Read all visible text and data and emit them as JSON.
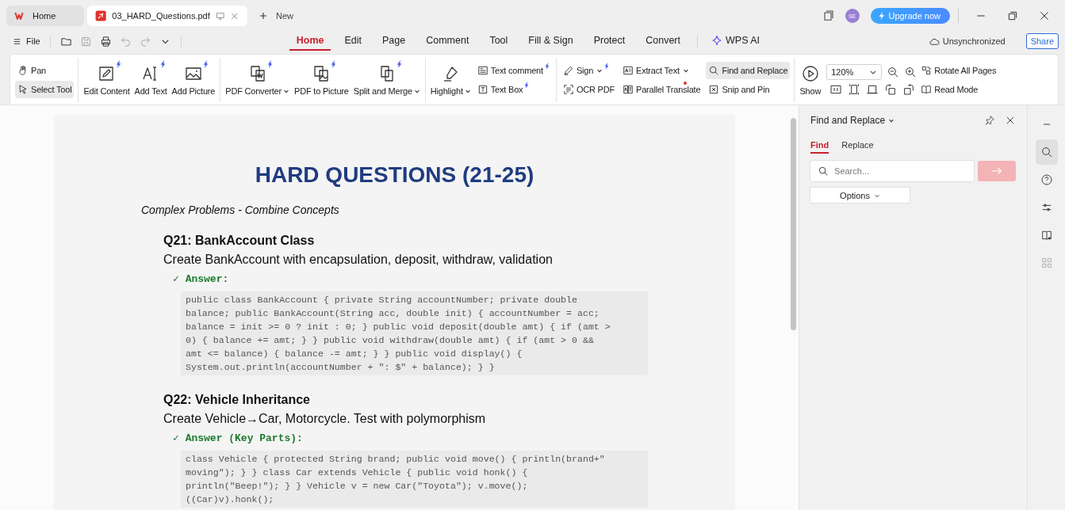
{
  "tabs": [
    {
      "label": "Home",
      "kind": "home",
      "selected": false
    },
    {
      "label": "03_HARD_Questions.pdf",
      "kind": "doc",
      "selected": true
    }
  ],
  "new_tab": "New",
  "avatar": "SE",
  "upgrade": "Upgrade now",
  "file_menu": "File",
  "ribbon_tabs": [
    {
      "label": "Home",
      "selected": true
    },
    {
      "label": "Edit",
      "selected": false
    },
    {
      "label": "Page",
      "selected": false
    },
    {
      "label": "Comment",
      "selected": false
    },
    {
      "label": "Tool",
      "selected": false
    },
    {
      "label": "Fill & Sign",
      "selected": false
    },
    {
      "label": "Protect",
      "selected": false
    },
    {
      "label": "Convert",
      "selected": false
    },
    {
      "label": "WPS AI",
      "selected": false,
      "kind": "ai"
    }
  ],
  "sync_status": "Unsynchronized",
  "share": "Share",
  "ribbon": {
    "groups": [
      {
        "columns": [
          {
            "kind": "small",
            "items": [
              {
                "label": "Pan",
                "selected": false
              },
              {
                "label": "Select Tool",
                "selected": true
              }
            ]
          }
        ]
      },
      {
        "columns": [
          {
            "kind": "large",
            "items": [
              {
                "label": "Edit Content",
                "selected": false,
                "spark": true
              }
            ]
          },
          {
            "kind": "large",
            "items": [
              {
                "label": "Add Text",
                "selected": false,
                "spark": true
              }
            ]
          },
          {
            "kind": "large",
            "items": [
              {
                "label": "Add Picture",
                "selected": false,
                "spark": true
              }
            ]
          }
        ]
      },
      {
        "columns": [
          {
            "kind": "large",
            "items": [
              {
                "label": "PDF Converter",
                "selected": false,
                "spark": true,
                "dropdown": true
              }
            ]
          },
          {
            "kind": "large",
            "items": [
              {
                "label": "PDF to Picture",
                "selected": false,
                "spark": true
              }
            ]
          },
          {
            "kind": "large",
            "items": [
              {
                "label": "Split and Merge",
                "selected": false,
                "spark": true,
                "dropdown": true
              }
            ]
          }
        ]
      },
      {
        "columns": [
          {
            "kind": "large",
            "items": [
              {
                "label": "Highlight",
                "selected": false,
                "dropdown": true
              }
            ]
          },
          {
            "kind": "small",
            "items": [
              {
                "label": "Text comment",
                "selected": false,
                "spark": true
              },
              {
                "label": "Text Box",
                "selected": false,
                "spark": true
              }
            ]
          }
        ]
      },
      {
        "columns": [
          {
            "kind": "small",
            "items": [
              {
                "label": "Sign",
                "selected": false,
                "spark": true,
                "dropdown": true
              },
              {
                "label": "OCR PDF",
                "selected": false
              }
            ]
          },
          {
            "kind": "small",
            "items": [
              {
                "label": "Extract Text",
                "selected": false,
                "dropdown": true
              },
              {
                "label": "Parallel Translate",
                "selected": false,
                "dot": true
              }
            ]
          },
          {
            "kind": "small",
            "items": [
              {
                "label": "Find and Replace",
                "selected": true
              },
              {
                "label": "Snip and Pin",
                "selected": false
              }
            ]
          }
        ]
      },
      {
        "columns": [
          {
            "kind": "large",
            "items": [
              {
                "label": "Show",
                "selected": false
              }
            ]
          },
          {
            "kind": "zoom",
            "value": "120%"
          },
          {
            "kind": "small",
            "items": [
              {
                "label": "Rotate All Pages",
                "selected": false
              },
              {
                "label": "Read Mode",
                "selected": false
              }
            ]
          }
        ]
      }
    ]
  },
  "document": {
    "title": "HARD QUESTIONS (21-25)",
    "subtitle": "Complex Problems - Combine Concepts",
    "questions": [
      {
        "heading": "Q21: BankAccount Class",
        "prompt": "Create BankAccount with encapsulation, deposit, withdraw, validation",
        "answer_label": "✓ Answer:",
        "code": [
          "public class BankAccount { private String accountNumber; private double",
          "balance; public BankAccount(String acc, double init) { accountNumber = acc;",
          "balance = init >= 0 ? init : 0; } public void deposit(double amt) { if (amt >",
          "0) { balance += amt; } } public void withdraw(double amt) { if (amt > 0 &&",
          "amt <= balance) { balance -= amt; } } public void display() {",
          "System.out.println(accountNumber + \": $\" + balance); } }"
        ]
      },
      {
        "heading": "Q22: Vehicle Inheritance",
        "prompt": "Create Vehicle→Car, Motorcycle. Test with polymorphism",
        "answer_label": "✓ Answer (Key Parts):",
        "code": [
          "class Vehicle { protected String brand; public void move() { println(brand+\"",
          "moving\"); } } class Car extends Vehicle { public void honk() {",
          "println(\"Beep!\"); } } Vehicle v = new Car(\"Toyota\"); v.move();",
          "((Car)v).honk();"
        ]
      }
    ]
  },
  "find_panel": {
    "title": "Find and Replace",
    "tabs": [
      {
        "label": "Find",
        "selected": true
      },
      {
        "label": "Replace",
        "selected": false
      }
    ],
    "search": {
      "placeholder": "Search..."
    },
    "go_disabled": true,
    "options": "Options"
  },
  "side_rail": [
    {
      "selected": false
    },
    {
      "selected": true
    },
    {
      "selected": false
    },
    {
      "selected": false
    },
    {
      "selected": false
    },
    {
      "selected": false
    }
  ]
}
